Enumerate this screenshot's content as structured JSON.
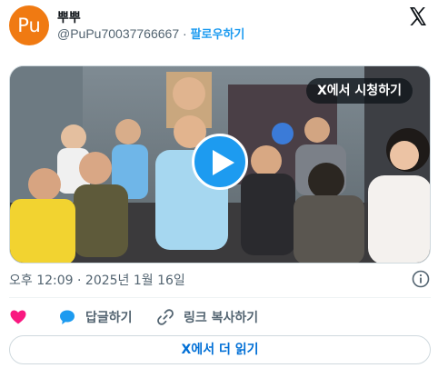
{
  "author": {
    "avatar_text": "Pu",
    "name": "뿌뿌",
    "handle": "@PuPu70037766667",
    "separator": "·",
    "follow_label": "팔로우하기"
  },
  "media": {
    "overlay_text": "X에서 시청하기"
  },
  "tweet": {
    "timestamp": "오후 12:09 · 2025년 1월 16일"
  },
  "actions": {
    "reply_label": "답글하기",
    "copy_link_label": "링크 복사하기"
  },
  "footer": {
    "read_more_label": "X에서 더 읽기"
  },
  "colors": {
    "accent": "#1d9bf0",
    "like": "#f91880",
    "avatar": "#f07a12"
  },
  "icons": [
    "x-logo-icon",
    "play-icon",
    "info-icon",
    "heart-icon",
    "reply-bubble-icon",
    "link-icon"
  ]
}
